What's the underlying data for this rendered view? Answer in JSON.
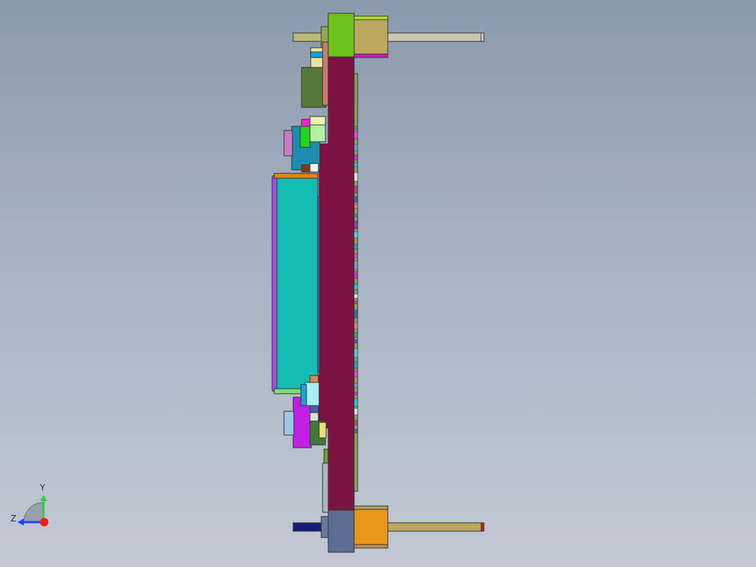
{
  "viewport": {
    "background_top": "#8a99ac",
    "background_bottom": "#c2c9d4"
  },
  "model": {
    "view": "side",
    "colors": {
      "pcb": "#7b1242",
      "lcd_module": "#14bcb4",
      "lcd_frame": "#a24fe3",
      "standoff_top": "#bba85e",
      "standoff_bottom": "#e9961a",
      "spacer_top": "#6cc11a",
      "spacer_bottom": "#5c6d93",
      "screw_shaft": "#c9c6ad"
    }
  },
  "triad": {
    "y_label": "Y",
    "z_label": "Z",
    "y_color": "#2ecc40",
    "z_color": "#1e40ff",
    "x_color": "#ff1a1a"
  }
}
